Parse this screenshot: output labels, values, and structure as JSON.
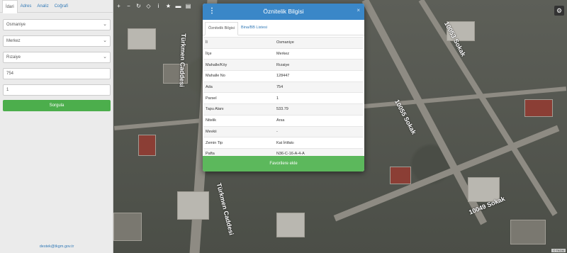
{
  "sidebar": {
    "tabs": [
      "İdari",
      "Adres",
      "Analiz",
      "Coğrafi"
    ],
    "province": "Osmaniye",
    "district": "Merkez",
    "neighborhood": "Rızaiye",
    "ada_value": "754",
    "parsel_value": "1",
    "query_label": "Sorgula",
    "footer_email": "destek@tkgm.gov.tr"
  },
  "map": {
    "toolbar_icons": [
      "plus-icon",
      "minus-icon",
      "refresh-icon",
      "locate-icon",
      "info-icon",
      "star-icon",
      "measure-icon",
      "print-icon"
    ],
    "streets": [
      "10053 Sokak",
      "10055 Sokak",
      "10049 Sokak",
      "Türkmen Caddesi",
      "Türkmen Caddesi"
    ],
    "attribution": "© TKGM"
  },
  "modal": {
    "title": "Öznitelik Bilgisi",
    "tabs": [
      "Öznitelik Bilgisi",
      "Bina/BB Listesi"
    ],
    "rows": [
      {
        "k": "İl",
        "v": "Osmaniye"
      },
      {
        "k": "İlçe",
        "v": "Merkez"
      },
      {
        "k": "Mahalle/Köy",
        "v": "Rızaiye"
      },
      {
        "k": "Mahalle No",
        "v": "128447"
      },
      {
        "k": "Ada",
        "v": "754"
      },
      {
        "k": "Parsel",
        "v": "1"
      },
      {
        "k": "Tapu Alanı",
        "v": "533.79"
      },
      {
        "k": "Nitelik",
        "v": "Arsa"
      },
      {
        "k": "Mevkii",
        "v": "-"
      },
      {
        "k": "Zemin Tip",
        "v": "Kat İrtifakı"
      },
      {
        "k": "Pafta",
        "v": "N36-C-16-A-4-A"
      }
    ],
    "favorite_label": "Favorilere ekle"
  }
}
